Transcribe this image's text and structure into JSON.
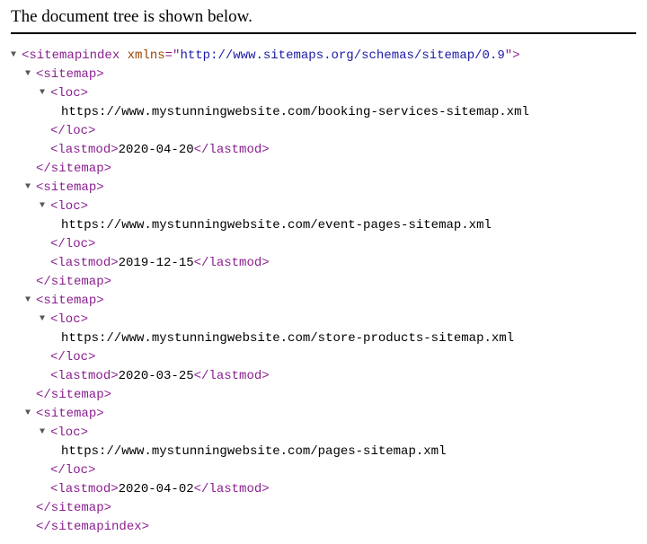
{
  "heading": "The document tree is shown below.",
  "tags": {
    "index_open_name": "sitemapindex",
    "index_attr_name": "xmlns",
    "index_attr_val": "http://www.sitemaps.org/schemas/sitemap/0.9",
    "sitemap": "sitemap",
    "loc": "loc",
    "lastmod": "lastmod",
    "index_close": "</sitemapindex>",
    "sitemap_close": "</sitemap>",
    "loc_close": "</loc>",
    "lastmod_close": "</lastmod>"
  },
  "entries": [
    {
      "loc": "https://www.mystunningwebsite.com/booking-services-sitemap.xml",
      "lastmod": "2020-04-20"
    },
    {
      "loc": "https://www.mystunningwebsite.com/event-pages-sitemap.xml",
      "lastmod": "2019-12-15"
    },
    {
      "loc": "https://www.mystunningwebsite.com/store-products-sitemap.xml",
      "lastmod": "2020-03-25"
    },
    {
      "loc": "https://www.mystunningwebsite.com/pages-sitemap.xml",
      "lastmod": "2020-04-02"
    }
  ]
}
